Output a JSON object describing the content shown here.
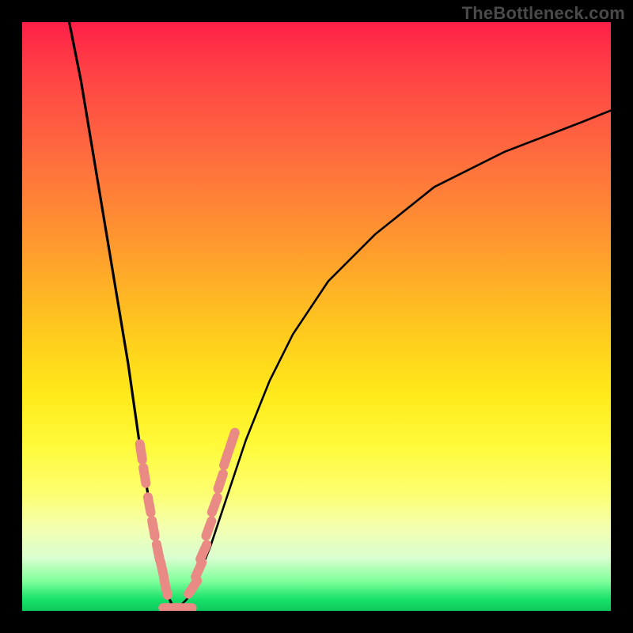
{
  "watermark": {
    "text": "TheBottleneck.com"
  },
  "colors": {
    "frame": "#000000",
    "curve": "#000000",
    "marker": "#e98a84",
    "gradient_stops": [
      "#ff1f47",
      "#ff4046",
      "#ff6a3f",
      "#ff9a2e",
      "#ffc81e",
      "#ffe91a",
      "#fffa3a",
      "#fdff70",
      "#f3ffb0",
      "#d9ffd0",
      "#7fff9a",
      "#18e26a",
      "#0dc95c"
    ]
  },
  "chart_data": {
    "type": "line",
    "title": "",
    "xlabel": "",
    "ylabel": "",
    "xlim": [
      0,
      100
    ],
    "ylim": [
      0,
      100
    ],
    "grid": false,
    "note": "V-shaped bottleneck curve; y≈0 is optimal (green), higher y is worse (red). Values are visual estimates from the figure.",
    "series": [
      {
        "name": "left-branch",
        "x": [
          8,
          10,
          12,
          14,
          16,
          18,
          19,
          20,
          21,
          22,
          23,
          24,
          25,
          26
        ],
        "y": [
          100,
          90,
          78,
          66,
          54,
          42,
          35,
          28,
          22,
          16,
          11,
          6,
          2,
          0
        ]
      },
      {
        "name": "right-branch",
        "x": [
          26,
          28,
          30,
          32,
          34,
          36,
          38,
          42,
          46,
          52,
          60,
          70,
          82,
          95,
          100
        ],
        "y": [
          0,
          2,
          6,
          11,
          17,
          23,
          29,
          39,
          47,
          56,
          64,
          72,
          78,
          83,
          85
        ]
      }
    ],
    "markers": {
      "note": "pink capsule-shaped markers clustered near the trough on both branches",
      "points": [
        {
          "branch": "left",
          "x": 20.2,
          "y": 27
        },
        {
          "branch": "left",
          "x": 20.8,
          "y": 23
        },
        {
          "branch": "left",
          "x": 21.6,
          "y": 18
        },
        {
          "branch": "left",
          "x": 22.3,
          "y": 14
        },
        {
          "branch": "left",
          "x": 23.1,
          "y": 10
        },
        {
          "branch": "left",
          "x": 23.8,
          "y": 7
        },
        {
          "branch": "left",
          "x": 24.4,
          "y": 4
        },
        {
          "branch": "floor",
          "x": 25.3,
          "y": 0.5
        },
        {
          "branch": "floor",
          "x": 26.4,
          "y": 0.3
        },
        {
          "branch": "floor",
          "x": 27.5,
          "y": 0.5
        },
        {
          "branch": "right",
          "x": 29.0,
          "y": 4
        },
        {
          "branch": "right",
          "x": 30.0,
          "y": 7
        },
        {
          "branch": "right",
          "x": 30.8,
          "y": 10
        },
        {
          "branch": "right",
          "x": 31.7,
          "y": 14
        },
        {
          "branch": "right",
          "x": 32.7,
          "y": 18
        },
        {
          "branch": "right",
          "x": 33.7,
          "y": 22
        },
        {
          "branch": "right",
          "x": 34.7,
          "y": 26
        },
        {
          "branch": "right",
          "x": 35.7,
          "y": 29
        }
      ]
    }
  }
}
